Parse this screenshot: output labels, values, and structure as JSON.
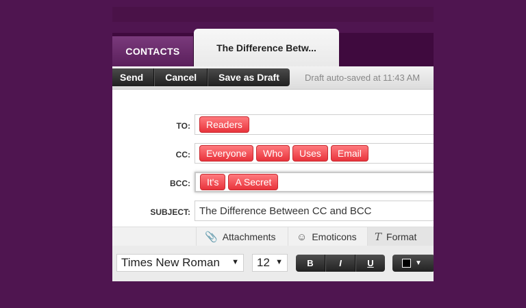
{
  "tabs": {
    "contacts": "CONTACTS",
    "active": "The Difference Betw..."
  },
  "toolbar": {
    "send": "Send",
    "cancel": "Cancel",
    "save_draft": "Save as Draft",
    "autosave": "Draft auto-saved at 11:43 AM"
  },
  "form": {
    "to_label": "TO:",
    "cc_label": "CC:",
    "bcc_label": "BCC:",
    "subject_label": "SUBJECT:",
    "to": [
      "Readers"
    ],
    "cc": [
      "Everyone",
      "Who",
      "Uses",
      "Email"
    ],
    "bcc": [
      "It's",
      "A Secret"
    ],
    "subject": "The Difference Between CC and BCC"
  },
  "options": {
    "attachments": "Attachments",
    "emoticons": "Emoticons",
    "format": "Format"
  },
  "format": {
    "font": "Times New Roman",
    "size": "12",
    "bold": "B",
    "italic": "I",
    "underline": "U"
  },
  "colors": {
    "chip": "#e8333b",
    "background": "#4f1550",
    "tabbar": "#3f0a3e"
  },
  "icons": {
    "attachments": "paperclip-icon",
    "emoticons": "smiley-icon",
    "format": "format-t-icon",
    "dropdown": "chevron-down-icon"
  }
}
